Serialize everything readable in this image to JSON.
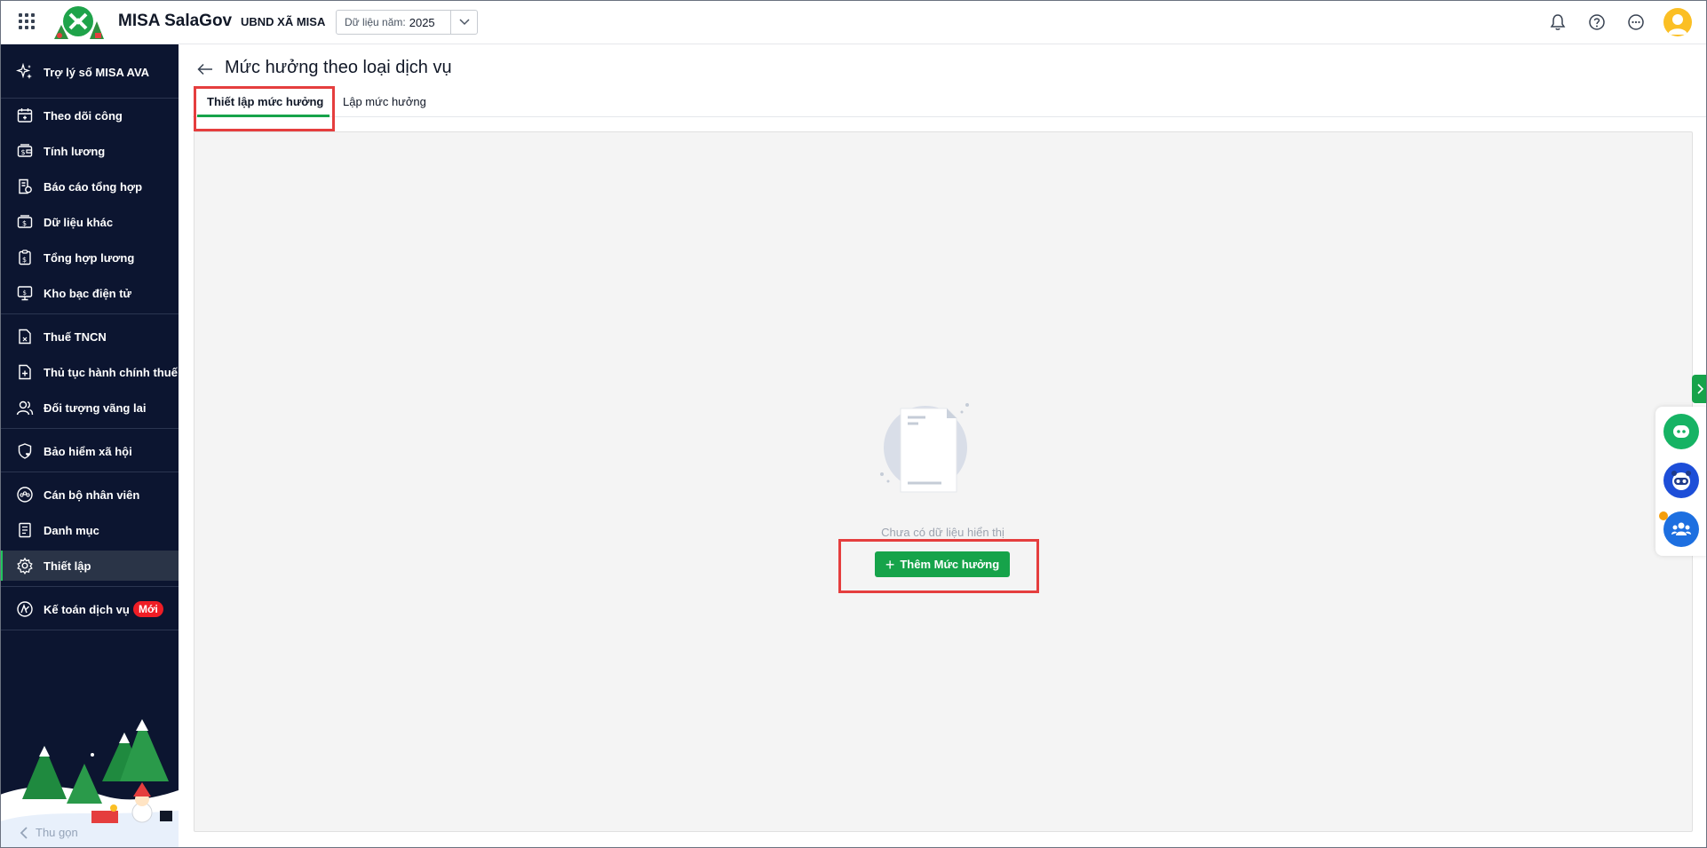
{
  "app": {
    "name": "MISA SalaGov",
    "org": "UBND XÃ MISA",
    "year_label": "Dữ liệu năm:",
    "year_value": "2025"
  },
  "sidebar": {
    "assistant": "Trợ lý số MISA AVA",
    "items": [
      {
        "label": "Theo dõi công",
        "icon": "calendar-icon"
      },
      {
        "label": "Tính lương",
        "icon": "wallet-icon"
      },
      {
        "label": "Báo cáo tổng hợp",
        "icon": "report-icon"
      },
      {
        "label": "Dữ liệu khác",
        "icon": "money-icon"
      },
      {
        "label": "Tổng hợp lương",
        "icon": "clipboard-icon"
      },
      {
        "label": "Kho bạc điện tử",
        "icon": "monitor-icon"
      },
      {
        "label": "Thuế TNCN",
        "icon": "tax-icon"
      },
      {
        "label": "Thủ tục hành chính thuế",
        "icon": "document-plus-icon"
      },
      {
        "label": "Đối tượng vãng lai",
        "icon": "users-icon"
      },
      {
        "label": "Bảo hiểm xã hội",
        "icon": "shield-icon"
      },
      {
        "label": "Cán bộ nhân viên",
        "icon": "staff-icon"
      },
      {
        "label": "Danh mục",
        "icon": "list-icon"
      },
      {
        "label": "Thiết lập",
        "icon": "gear-icon"
      },
      {
        "label": "Kế toán dịch vụ",
        "icon": "accounting-icon"
      }
    ],
    "new_badge": "Mới",
    "collapse": "Thu gọn",
    "active_index": 12
  },
  "page": {
    "title": "Mức hưởng theo loại dịch vụ",
    "tabs": [
      {
        "label": "Thiết lập mức hưởng",
        "active": true
      },
      {
        "label": "Lập mức hưởng",
        "active": false
      }
    ],
    "empty_message": "Chưa có dữ liệu hiển thị",
    "add_button": "Thêm Mức hưởng"
  },
  "colors": {
    "sidebar_bg": "#0c1530",
    "accent_green": "#16a34a",
    "highlight_red": "#e53e3e",
    "new_badge_red": "#ef1d25"
  }
}
